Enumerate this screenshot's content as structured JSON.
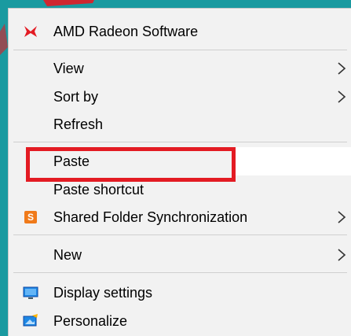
{
  "menu": {
    "items": [
      {
        "label": "AMD Radeon Software",
        "icon": "amd-radeon-icon"
      },
      {
        "label": "View",
        "submenu": true
      },
      {
        "label": "Sort by",
        "submenu": true
      },
      {
        "label": "Refresh"
      },
      {
        "label": "Paste",
        "highlighted": true
      },
      {
        "label": "Paste shortcut"
      },
      {
        "label": "Shared Folder Synchronization",
        "icon": "shared-folder-sync-icon",
        "submenu": true
      },
      {
        "label": "New",
        "submenu": true
      },
      {
        "label": "Display settings",
        "icon": "display-settings-icon"
      },
      {
        "label": "Personalize",
        "icon": "personalize-icon"
      }
    ]
  },
  "colors": {
    "menu_bg": "#f2f2f2",
    "highlight_box": "#e31b23",
    "amd_icon": "#e31b23",
    "shared_folder_icon": "#f07a1a",
    "display_icon": "#1e88e5",
    "teal_backdrop": "#1a9aa0"
  }
}
